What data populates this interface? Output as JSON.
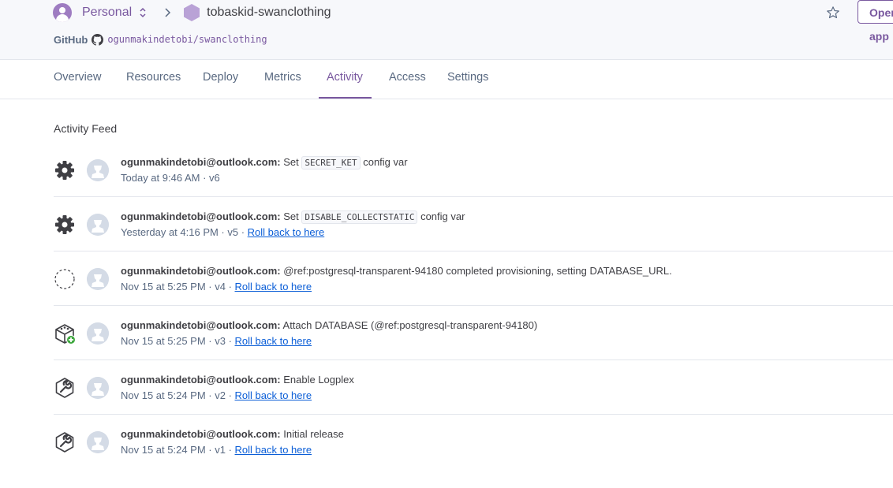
{
  "header": {
    "account": "Personal",
    "app_name": "tobaskid-swanclothing",
    "open_button": "Open app",
    "github_label": "GitHub",
    "repo": "ogunmakindetobi/swanclothing"
  },
  "tabs": [
    "Overview",
    "Resources",
    "Deploy",
    "Metrics",
    "Activity",
    "Access",
    "Settings"
  ],
  "active_tab": "Activity",
  "feed": {
    "title": "Activity Feed",
    "items": [
      {
        "icon": "gear-icon",
        "user": "ogunmakindetobi@outlook.com:",
        "pre": " Set ",
        "code": "SECRET_KET",
        "post": " config var",
        "meta": "Today at 9:46 AM · v6",
        "rollback": ""
      },
      {
        "icon": "gear-icon",
        "user": "ogunmakindetobi@outlook.com:",
        "pre": " Set ",
        "code": "DISABLE_COLLECTSTATIC",
        "post": " config var",
        "meta": "Yesterday at 4:16 PM · v5 · ",
        "rollback": "Roll back to here"
      },
      {
        "icon": "dashed-circle-icon",
        "user": "ogunmakindetobi@outlook.com:",
        "pre": " @ref:postgresql-transparent-94180 completed provisioning, setting DATABASE_URL.",
        "code": "",
        "post": "",
        "meta": "Nov 15 at 5:25 PM · v4 · ",
        "rollback": "Roll back to here"
      },
      {
        "icon": "addon-attach-icon",
        "user": "ogunmakindetobi@outlook.com:",
        "pre": " Attach DATABASE (@ref:postgresql-transparent-94180)",
        "code": "",
        "post": "",
        "meta": "Nov 15 at 5:25 PM · v3 · ",
        "rollback": "Roll back to here"
      },
      {
        "icon": "wrench-icon",
        "user": "ogunmakindetobi@outlook.com:",
        "pre": " Enable Logplex",
        "code": "",
        "post": "",
        "meta": "Nov 15 at 5:24 PM · v2 · ",
        "rollback": "Roll back to here"
      },
      {
        "icon": "wrench-icon",
        "user": "ogunmakindetobi@outlook.com:",
        "pre": " Initial release",
        "code": "",
        "post": "",
        "meta": "Nov 15 at 5:24 PM · v1 · ",
        "rollback": "Roll back to here"
      }
    ]
  }
}
